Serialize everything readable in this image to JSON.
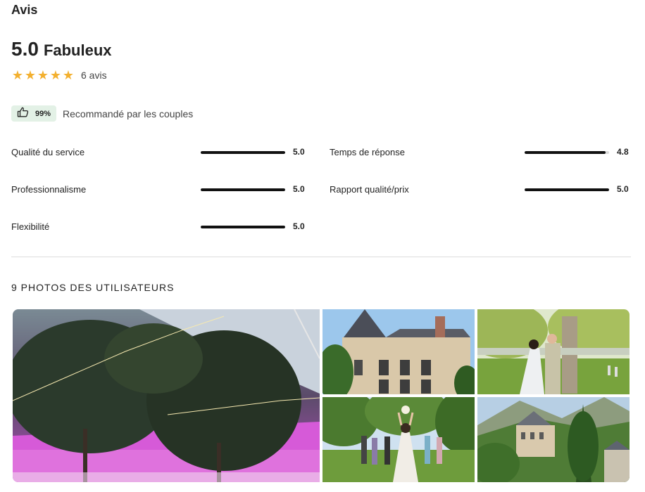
{
  "reviews": {
    "title": "Avis",
    "score": "5.0",
    "score_label": "Fabuleux",
    "stars": 5,
    "star_color": "#f3b02f",
    "review_count": "6 avis",
    "recommend": {
      "percent": "99%",
      "text": "Recommandé par les couples",
      "badge_color": "#e3f1e6"
    },
    "ratings": [
      {
        "label": "Qualité du service",
        "value": "5.0",
        "fraction": 1.0
      },
      {
        "label": "Temps de réponse",
        "value": "4.8",
        "fraction": 0.96
      },
      {
        "label": "Professionnalisme",
        "value": "5.0",
        "fraction": 1.0
      },
      {
        "label": "Rapport qualité/prix",
        "value": "5.0",
        "fraction": 1.0
      },
      {
        "label": "Flexibilité",
        "value": "5.0",
        "fraction": 1.0
      }
    ]
  },
  "photos": {
    "title": "9 PHOTOS DES UTILISATEURS",
    "items": [
      {
        "name": "photo-tent-evening"
      },
      {
        "name": "photo-chateau-facade"
      },
      {
        "name": "photo-couple-garden"
      },
      {
        "name": "photo-bouquet-toss"
      },
      {
        "name": "photo-chateau-valley"
      }
    ]
  }
}
